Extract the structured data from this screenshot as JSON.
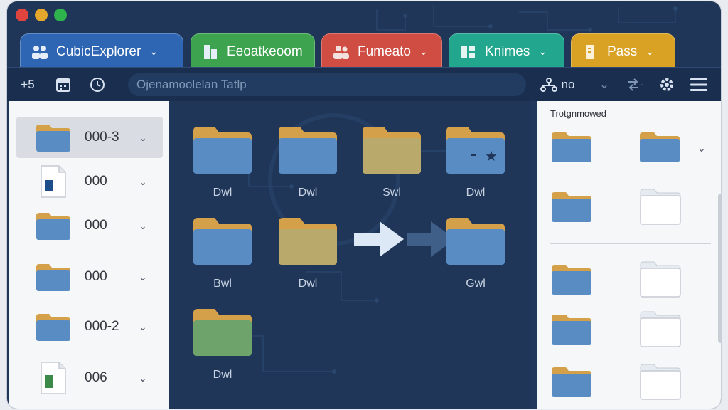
{
  "window": {
    "traffic_lights": [
      "#e0443e",
      "#e3a72b",
      "#2fb34d"
    ]
  },
  "tabs": [
    {
      "label": "CubicExplorer",
      "color": "#2f66b4",
      "icon": "users-icon"
    },
    {
      "label": "Eeoatkeoom",
      "color": "#3ea34e",
      "icon": "document-icon"
    },
    {
      "label": "Fumeato",
      "color": "#cf4d42",
      "icon": "users-icon"
    },
    {
      "label": "Knimes",
      "color": "#23a68e",
      "icon": "grid-icon"
    },
    {
      "label": "Pass",
      "color": "#d9a224",
      "icon": "document-icon"
    }
  ],
  "toolbar": {
    "new_label": "+5",
    "search_placeholder": "Ojenamoolelan   Tatlp",
    "network_label": "no",
    "transfer_label": "-"
  },
  "sidebar": {
    "items": [
      {
        "label": "000-3",
        "icon": "folder-icon",
        "selected": true
      },
      {
        "label": "000",
        "icon": "file-blue-icon",
        "selected": false
      },
      {
        "label": "000",
        "icon": "folder-icon",
        "selected": false
      },
      {
        "label": "000",
        "icon": "folder-icon",
        "selected": false
      },
      {
        "label": "000-2",
        "icon": "folder-icon",
        "selected": false
      },
      {
        "label": "006",
        "icon": "file-green-icon",
        "selected": false
      }
    ]
  },
  "grid": {
    "items": [
      {
        "label": "Dwl",
        "color": "#5a8cc4"
      },
      {
        "label": "Dwl",
        "color": "#5a8cc4"
      },
      {
        "label": "Swl",
        "color": "#b9a96a"
      },
      {
        "label": "Dwl",
        "color": "#5a8cc4",
        "starred": true
      },
      {
        "label": "Bwl",
        "color": "#5a8cc4"
      },
      {
        "label": "Dwl",
        "color": "#b9a96a"
      },
      {
        "label": "Gwl",
        "color": "#5a8cc4"
      },
      {
        "label": "Dwl",
        "color": "#6ea36c"
      }
    ]
  },
  "right_panel": {
    "title": "Trotgnmowed"
  },
  "colors": {
    "window_bg": "#1f3658",
    "folder_tab": "#d5a04a",
    "folder_blue": "#5a8cc4"
  }
}
